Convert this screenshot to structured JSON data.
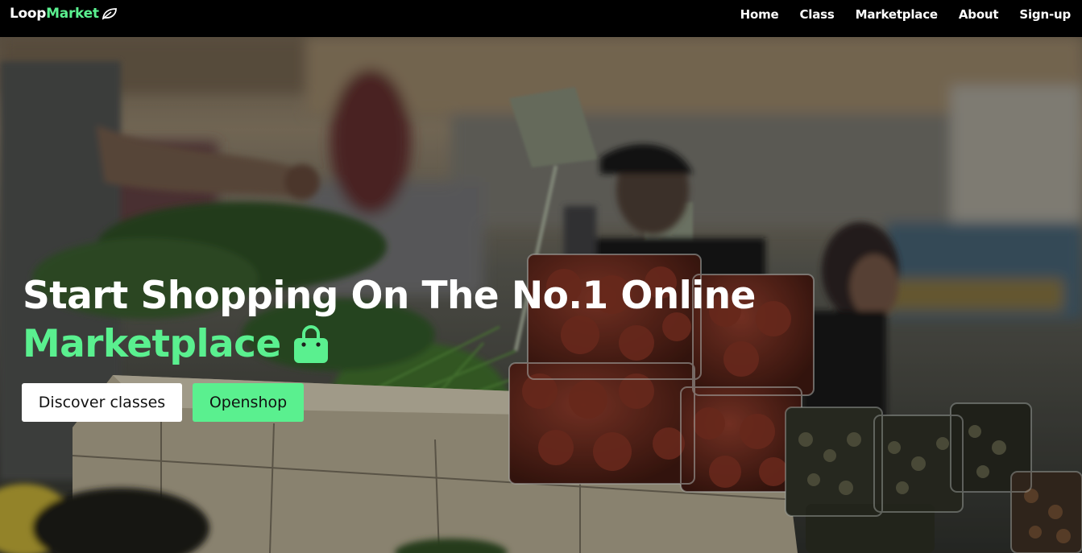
{
  "brand": {
    "name_part1": "Loop",
    "name_part2": "Market",
    "icon": "leaf-icon"
  },
  "nav": {
    "items": [
      {
        "label": "Home"
      },
      {
        "label": "Class"
      },
      {
        "label": "Marketplace"
      },
      {
        "label": "About"
      },
      {
        "label": "Sign-up"
      }
    ]
  },
  "hero": {
    "title_line1": "Start Shopping On The No.1 Online",
    "title_line2": "Marketplace",
    "title_icon": "shopping-bag-icon",
    "buttons": {
      "discover_label": "Discover classes",
      "openshop_label": "Openshop"
    }
  },
  "colors": {
    "accent": "#5af08f",
    "navbar_bg": "#000000",
    "text": "#ffffff"
  }
}
